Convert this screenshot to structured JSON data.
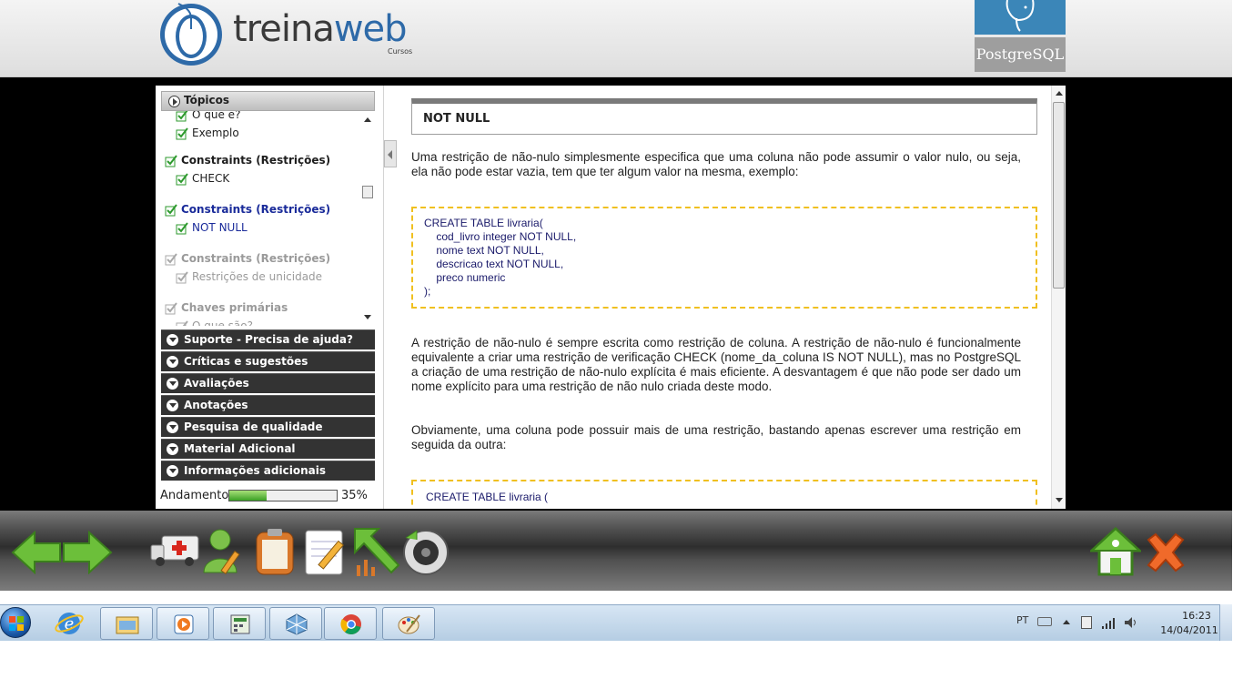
{
  "header": {
    "logo_word_a": "treina",
    "logo_word_b": "web",
    "logo_sub": "Cursos",
    "partner_logo_text": "PostgreSQL"
  },
  "sidebar": {
    "topics_title": "Tópicos",
    "topic_items": [
      {
        "label": "O que é?",
        "kind": "sub",
        "state": "done"
      },
      {
        "label": "Exemplo",
        "kind": "sub",
        "state": "done"
      },
      {
        "label": "Constraints (Restrições)",
        "kind": "section",
        "state": "done"
      },
      {
        "label": "CHECK",
        "kind": "sub",
        "state": "done"
      },
      {
        "label": "Constraints (Restrições)",
        "kind": "section",
        "state": "active"
      },
      {
        "label": "NOT NULL",
        "kind": "sub",
        "state": "active"
      },
      {
        "label": "Constraints (Restrições)",
        "kind": "section",
        "state": "pending"
      },
      {
        "label": "Restrições de unicidade",
        "kind": "sub",
        "state": "pending"
      },
      {
        "label": "Chaves primárias",
        "kind": "section",
        "state": "pending"
      },
      {
        "label": "O que são?",
        "kind": "sub",
        "state": "pending"
      }
    ],
    "accordion": [
      "Suporte - Precisa de ajuda?",
      "Críticas e sugestões",
      "Avaliações",
      "Anotações",
      "Pesquisa de qualidade",
      "Material Adicional",
      "Informações adicionais"
    ],
    "progress_label": "Andamento",
    "progress_percent": 35,
    "progress_text": "35%"
  },
  "content": {
    "section_title": "NOT NULL",
    "para1": "Uma restrição de não-nulo simplesmente especifica que uma coluna não pode assumir o valor nulo, ou seja, ela não pode estar vazia, tem que ter algum valor na mesma, exemplo:",
    "code1": [
      "CREATE TABLE livraria(",
      "    cod_livro integer NOT NULL,",
      "    nome text NOT NULL,",
      "    descricao text NOT NULL,",
      "    preco numeric",
      ");"
    ],
    "para2": "A restrição de não-nulo é sempre escrita como restrição de coluna. A restrição de não-nulo é funcionalmente equivalente a criar uma restrição de verificação CHECK (nome_da_coluna IS NOT NULL), mas no PostgreSQL a criação de uma restrição de não-nulo explícita é mais eficiente. A desvantagem é que não pode ser dado um nome explícito para uma restrição de não nulo criada deste modo.",
    "para3": "Obviamente, uma coluna pode possuir mais de uma restrição, bastando apenas escrever uma restrição em seguida da outra:",
    "code2": [
      "CREATE TABLE livraria ("
    ]
  },
  "toolbar": {
    "icons": [
      "back-arrow-icon",
      "forward-arrow-icon",
      "ambulance-icon",
      "user-edit-icon",
      "clipboard-icon",
      "notepad-pencil-icon",
      "up-chart-arrow-icon",
      "record-disc-icon",
      "home-icon",
      "close-x-icon"
    ]
  },
  "taskbar": {
    "language": "PT",
    "time": "16:23",
    "date": "14/04/2011",
    "apps": [
      "internet-explorer-icon",
      "file-explorer-icon",
      "media-player-icon",
      "calculator-spreadsheet-icon",
      "virtualbox-icon",
      "chrome-icon",
      "paint-icon"
    ]
  },
  "colors": {
    "accent_green": "#5aa83a",
    "link_blue": "#1a2b9a",
    "code_border": "#f0c020",
    "toolbar_dark": "#2e2e2e"
  }
}
